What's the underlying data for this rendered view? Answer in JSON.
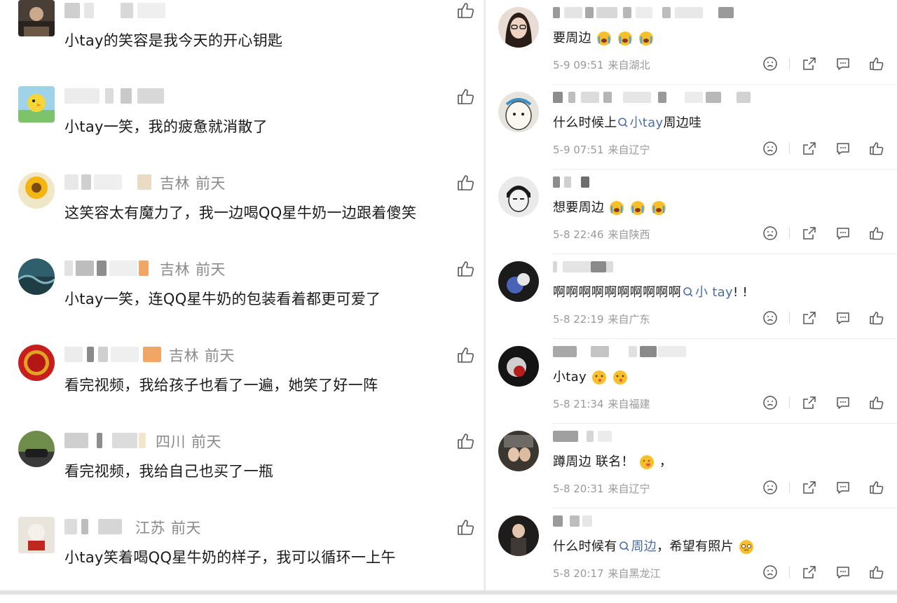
{
  "left_comments": [
    {
      "location": "",
      "time": "",
      "text": "小tay的笑容是我今天的开心钥匙"
    },
    {
      "location": "",
      "time": "",
      "text": "小tay一笑，我的疲惫就消散了"
    },
    {
      "location": "吉林",
      "time": "前天",
      "text": "这笑容太有魔力了，我一边喝QQ星牛奶一边跟着傻笑"
    },
    {
      "location": "吉林",
      "time": "前天",
      "text": "小tay一笑，连QQ星牛奶的包装看着都更可爱了"
    },
    {
      "location": "吉林",
      "time": "前天",
      "text": "看完视频，我给孩子也看了一遍，她笑了好一阵"
    },
    {
      "location": "四川",
      "time": "前天",
      "text": "看完视频，我给自己也买了一瓶"
    },
    {
      "location": "江苏",
      "time": "前天",
      "text": "小tay笑着喝QQ星牛奶的样子，我可以循环一上午"
    }
  ],
  "right_comments": [
    {
      "before": "要周边",
      "mention": "",
      "after": "",
      "time": "5-9 09:51",
      "location": "来自湖北"
    },
    {
      "before": "什么时候上",
      "mention": "小tay",
      "after": "周边哇",
      "time": "5-9 07:51",
      "location": "来自辽宁"
    },
    {
      "before": "想要周边",
      "mention": "",
      "after": "",
      "time": "5-8 22:46",
      "location": "来自陕西"
    },
    {
      "before": "啊啊啊啊啊啊啊啊啊啊",
      "mention": "小 tay",
      "after": "! !",
      "time": "5-8 22:19",
      "location": "来自广东"
    },
    {
      "before": "小tay",
      "mention": "",
      "after": "",
      "time": "5-8 21:34",
      "location": "来自福建"
    },
    {
      "before": "蹲周边 联名！",
      "mention": "",
      "after": "，",
      "time": "5-8 20:31",
      "location": "来自辽宁"
    },
    {
      "before": "什么时候有",
      "mention": "周边",
      "after": "，希望有照片",
      "time": "5-8 20:17",
      "location": "来自黑龙江"
    }
  ],
  "icons": {
    "like": "thumbs-up-icon",
    "dislike": "dislike-face-icon",
    "share": "share-icon",
    "reply": "comment-icon",
    "search": "search-icon"
  },
  "colors": {
    "mention": "#4a6ea9",
    "meta": "#8a8a8a",
    "text": "#1a1a1a"
  }
}
